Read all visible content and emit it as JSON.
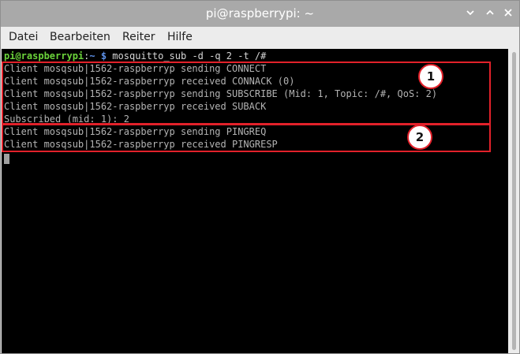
{
  "window": {
    "title": "pi@raspberrypi: ~",
    "minimize_icon": "chevron-down-icon",
    "maximize_icon": "chevron-up-icon",
    "close_icon": "close-icon"
  },
  "menubar": {
    "items": [
      "Datei",
      "Bearbeiten",
      "Reiter",
      "Hilfe"
    ]
  },
  "terminal": {
    "prompt_user": "pi@raspberrypi",
    "prompt_sep": ":",
    "prompt_path": "~ $",
    "command": " mosquitto_sub -d -q 2 -t /#",
    "lines": [
      "Client mosqsub|1562-raspberryp sending CONNECT",
      "Client mosqsub|1562-raspberryp received CONNACK (0)",
      "Client mosqsub|1562-raspberryp sending SUBSCRIBE (Mid: 1, Topic: /#, QoS: 2)",
      "Client mosqsub|1562-raspberryp received SUBACK",
      "Subscribed (mid: 1): 2",
      "Client mosqsub|1562-raspberryp sending PINGREQ",
      "Client mosqsub|1562-raspberryp received PINGRESP"
    ]
  },
  "annotations": {
    "badge_1": "1",
    "badge_2": "2",
    "accent_color": "#e2212a"
  }
}
